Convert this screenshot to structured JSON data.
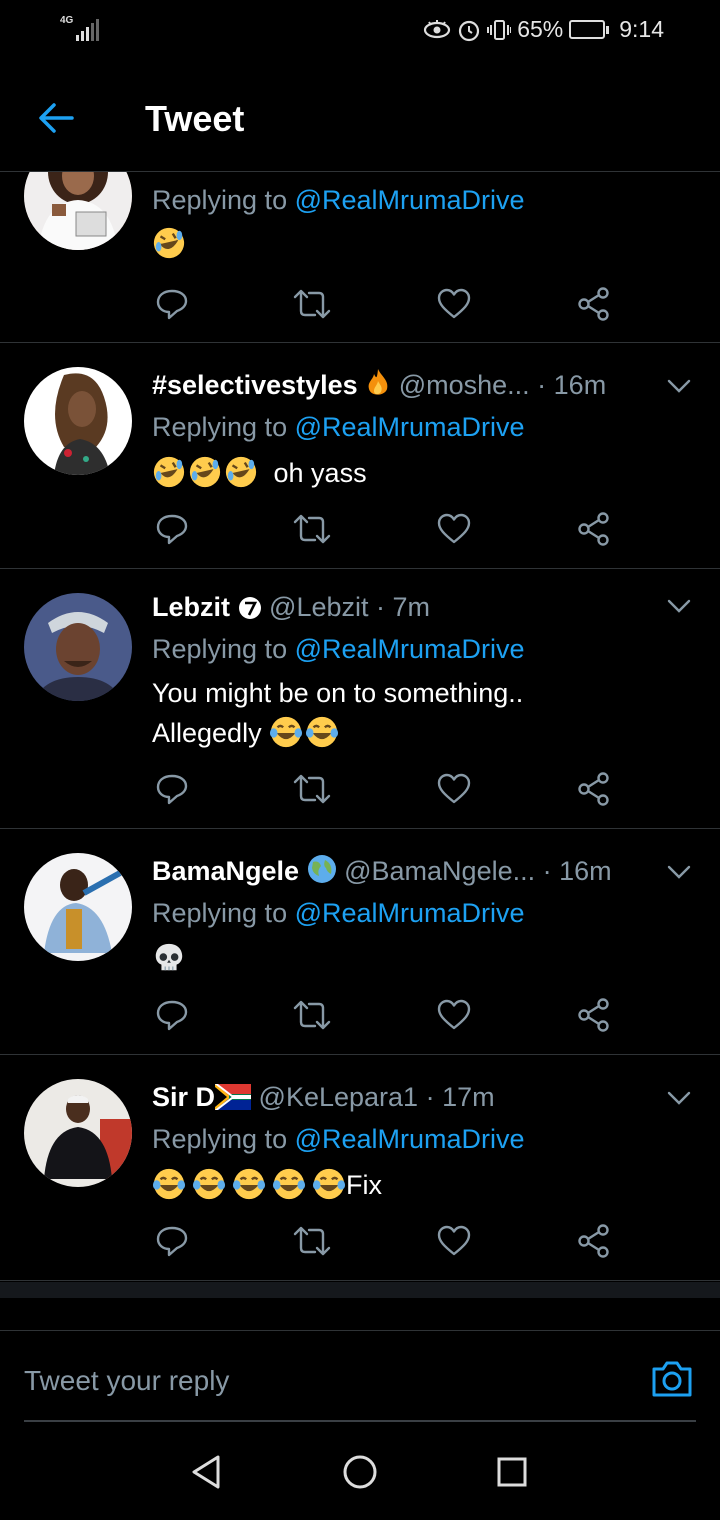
{
  "status_bar": {
    "network": "4G",
    "battery_text": "65%",
    "battery_level": 0.65,
    "time": "9:14",
    "icons": [
      "eye-comfort-icon",
      "alarm-icon",
      "vibrate-icon",
      "battery-icon"
    ]
  },
  "header": {
    "title": "Tweet",
    "back_icon": "arrow-left-icon"
  },
  "colors": {
    "accent": "#1da1f2",
    "muted": "#8899a6",
    "divider": "#2f3336",
    "background": "#000000"
  },
  "tweets": [
    {
      "name": "",
      "handle": "",
      "time": "",
      "reply_label": "Replying to",
      "mention": "@RealMrumaDrive",
      "emojis": [
        "rofl"
      ],
      "text": "",
      "text2": "",
      "avatar": "doctor-avatar"
    },
    {
      "name": "#selectivestyles",
      "name_badge": "fire-emoji",
      "handle": "@moshe...",
      "time": "· 16m",
      "reply_label": "Replying to",
      "mention": "@RealMrumaDrive",
      "emojis": [
        "rofl",
        "rofl",
        "rofl"
      ],
      "text": "oh yass",
      "text2": "",
      "avatar": "illustration-avatar"
    },
    {
      "name": "Lebzit",
      "name_badge": "number-seven-icon",
      "handle": "@Lebzit",
      "time": "· 7m",
      "reply_label": "Replying to",
      "mention": "@RealMrumaDrive",
      "text": "You might be  on to something..",
      "text2": "Allegedly",
      "emojis": [
        "joy",
        "joy"
      ],
      "avatar": "selfie-avatar"
    },
    {
      "name": "BamaNgele",
      "name_badge": "globe-emoji",
      "handle": "@BamaNgele...",
      "time": "· 16m",
      "reply_label": "Replying to",
      "mention": "@RealMrumaDrive",
      "emojis": [
        "skull"
      ],
      "text": "",
      "text2": "",
      "avatar": "jacket-avatar"
    },
    {
      "name": "Sir D",
      "name_badge": "south-africa-flag",
      "handle": "@KeLepara1",
      "time": "· 17m",
      "reply_label": "Replying to",
      "mention": "@RealMrumaDrive",
      "emojis": [
        "joy",
        "joy",
        "joy",
        "joy",
        "joy"
      ],
      "text": "Fix",
      "text2": "",
      "avatar": "seated-avatar"
    }
  ],
  "composer": {
    "placeholder": "Tweet your reply",
    "camera_icon": "camera-icon"
  },
  "nav": [
    "back-triangle-icon",
    "home-circle-icon",
    "recents-square-icon"
  ]
}
